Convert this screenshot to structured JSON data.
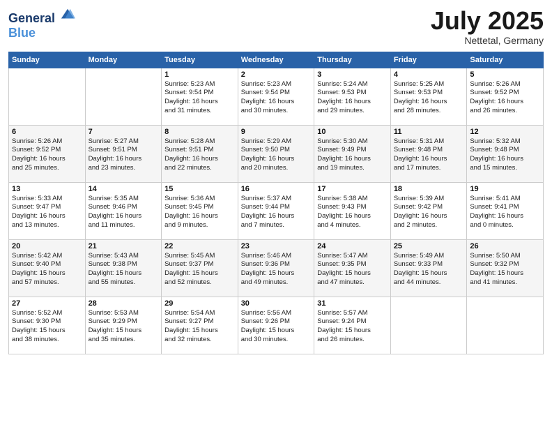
{
  "logo": {
    "line1": "General",
    "line2": "Blue"
  },
  "title": "July 2025",
  "subtitle": "Nettetal, Germany",
  "days_header": [
    "Sunday",
    "Monday",
    "Tuesday",
    "Wednesday",
    "Thursday",
    "Friday",
    "Saturday"
  ],
  "weeks": [
    [
      {
        "day": "",
        "info": ""
      },
      {
        "day": "",
        "info": ""
      },
      {
        "day": "1",
        "info": "Sunrise: 5:23 AM\nSunset: 9:54 PM\nDaylight: 16 hours\nand 31 minutes."
      },
      {
        "day": "2",
        "info": "Sunrise: 5:23 AM\nSunset: 9:54 PM\nDaylight: 16 hours\nand 30 minutes."
      },
      {
        "day": "3",
        "info": "Sunrise: 5:24 AM\nSunset: 9:53 PM\nDaylight: 16 hours\nand 29 minutes."
      },
      {
        "day": "4",
        "info": "Sunrise: 5:25 AM\nSunset: 9:53 PM\nDaylight: 16 hours\nand 28 minutes."
      },
      {
        "day": "5",
        "info": "Sunrise: 5:26 AM\nSunset: 9:52 PM\nDaylight: 16 hours\nand 26 minutes."
      }
    ],
    [
      {
        "day": "6",
        "info": "Sunrise: 5:26 AM\nSunset: 9:52 PM\nDaylight: 16 hours\nand 25 minutes."
      },
      {
        "day": "7",
        "info": "Sunrise: 5:27 AM\nSunset: 9:51 PM\nDaylight: 16 hours\nand 23 minutes."
      },
      {
        "day": "8",
        "info": "Sunrise: 5:28 AM\nSunset: 9:51 PM\nDaylight: 16 hours\nand 22 minutes."
      },
      {
        "day": "9",
        "info": "Sunrise: 5:29 AM\nSunset: 9:50 PM\nDaylight: 16 hours\nand 20 minutes."
      },
      {
        "day": "10",
        "info": "Sunrise: 5:30 AM\nSunset: 9:49 PM\nDaylight: 16 hours\nand 19 minutes."
      },
      {
        "day": "11",
        "info": "Sunrise: 5:31 AM\nSunset: 9:48 PM\nDaylight: 16 hours\nand 17 minutes."
      },
      {
        "day": "12",
        "info": "Sunrise: 5:32 AM\nSunset: 9:48 PM\nDaylight: 16 hours\nand 15 minutes."
      }
    ],
    [
      {
        "day": "13",
        "info": "Sunrise: 5:33 AM\nSunset: 9:47 PM\nDaylight: 16 hours\nand 13 minutes."
      },
      {
        "day": "14",
        "info": "Sunrise: 5:35 AM\nSunset: 9:46 PM\nDaylight: 16 hours\nand 11 minutes."
      },
      {
        "day": "15",
        "info": "Sunrise: 5:36 AM\nSunset: 9:45 PM\nDaylight: 16 hours\nand 9 minutes."
      },
      {
        "day": "16",
        "info": "Sunrise: 5:37 AM\nSunset: 9:44 PM\nDaylight: 16 hours\nand 7 minutes."
      },
      {
        "day": "17",
        "info": "Sunrise: 5:38 AM\nSunset: 9:43 PM\nDaylight: 16 hours\nand 4 minutes."
      },
      {
        "day": "18",
        "info": "Sunrise: 5:39 AM\nSunset: 9:42 PM\nDaylight: 16 hours\nand 2 minutes."
      },
      {
        "day": "19",
        "info": "Sunrise: 5:41 AM\nSunset: 9:41 PM\nDaylight: 16 hours\nand 0 minutes."
      }
    ],
    [
      {
        "day": "20",
        "info": "Sunrise: 5:42 AM\nSunset: 9:40 PM\nDaylight: 15 hours\nand 57 minutes."
      },
      {
        "day": "21",
        "info": "Sunrise: 5:43 AM\nSunset: 9:38 PM\nDaylight: 15 hours\nand 55 minutes."
      },
      {
        "day": "22",
        "info": "Sunrise: 5:45 AM\nSunset: 9:37 PM\nDaylight: 15 hours\nand 52 minutes."
      },
      {
        "day": "23",
        "info": "Sunrise: 5:46 AM\nSunset: 9:36 PM\nDaylight: 15 hours\nand 49 minutes."
      },
      {
        "day": "24",
        "info": "Sunrise: 5:47 AM\nSunset: 9:35 PM\nDaylight: 15 hours\nand 47 minutes."
      },
      {
        "day": "25",
        "info": "Sunrise: 5:49 AM\nSunset: 9:33 PM\nDaylight: 15 hours\nand 44 minutes."
      },
      {
        "day": "26",
        "info": "Sunrise: 5:50 AM\nSunset: 9:32 PM\nDaylight: 15 hours\nand 41 minutes."
      }
    ],
    [
      {
        "day": "27",
        "info": "Sunrise: 5:52 AM\nSunset: 9:30 PM\nDaylight: 15 hours\nand 38 minutes."
      },
      {
        "day": "28",
        "info": "Sunrise: 5:53 AM\nSunset: 9:29 PM\nDaylight: 15 hours\nand 35 minutes."
      },
      {
        "day": "29",
        "info": "Sunrise: 5:54 AM\nSunset: 9:27 PM\nDaylight: 15 hours\nand 32 minutes."
      },
      {
        "day": "30",
        "info": "Sunrise: 5:56 AM\nSunset: 9:26 PM\nDaylight: 15 hours\nand 30 minutes."
      },
      {
        "day": "31",
        "info": "Sunrise: 5:57 AM\nSunset: 9:24 PM\nDaylight: 15 hours\nand 26 minutes."
      },
      {
        "day": "",
        "info": ""
      },
      {
        "day": "",
        "info": ""
      }
    ]
  ]
}
